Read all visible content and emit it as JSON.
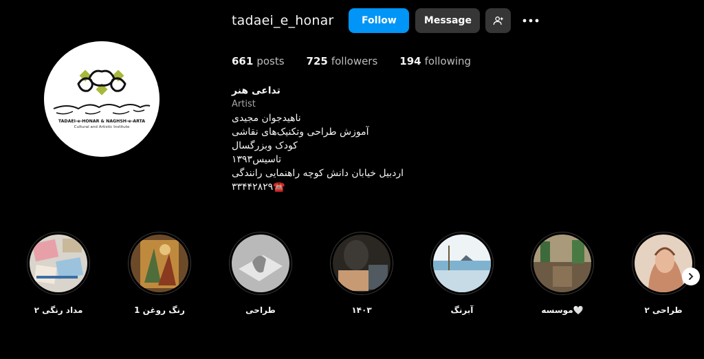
{
  "profile": {
    "username": "tadaei_e_honar",
    "logo_text_line1": "TADAEI-e-HONAR & NAGHSH-e-ARTA",
    "logo_text_line2": "Cultural and Artistic Institute",
    "logo_calligraphy": "موسسه فرهنگی هنری تداعی هنر و نقش آرتا"
  },
  "actions": {
    "follow_label": "Follow",
    "message_label": "Message",
    "suggest_icon": "add-person-icon",
    "more_icon": "more-options-icon"
  },
  "stats": {
    "posts_count": "661",
    "posts_label": "posts",
    "followers_count": "725",
    "followers_label": "followers",
    "following_count": "194",
    "following_label": "following"
  },
  "bio": {
    "name": "تداعی هنر",
    "category": "Artist",
    "lines": [
      "ناهیدجوان مجیدی",
      "آموزش طراحی وتکنیک‌های نقاشی",
      "کودک وبزرگسال",
      "تاسیس۱۳۹۳",
      "اردبیل خیابان دانش کوچه راهنمایی رانندگی",
      "۳۳۴۴۲۸۲۹☎️"
    ]
  },
  "highlights": [
    {
      "label": "مداد رنگی ۲",
      "thumb_icon": "colored-pencils-thumb"
    },
    {
      "label": "رنگ روغن 1",
      "thumb_icon": "oil-painting-thumb"
    },
    {
      "label": "طراحی",
      "thumb_icon": "sketch-thumb"
    },
    {
      "label": "۱۴۰۳",
      "thumb_icon": "studio-photo-thumb"
    },
    {
      "label": "آبرنگ",
      "thumb_icon": "watercolor-thumb"
    },
    {
      "label": "موسسه🤍",
      "thumb_icon": "institute-photo-thumb"
    },
    {
      "label": "طراحی ۲",
      "thumb_icon": "portrait-drawing-thumb"
    }
  ],
  "colors": {
    "background": "#000000",
    "follow_button": "#0095f6",
    "secondary_button": "#363636",
    "logo_green": "#a8b83a"
  }
}
